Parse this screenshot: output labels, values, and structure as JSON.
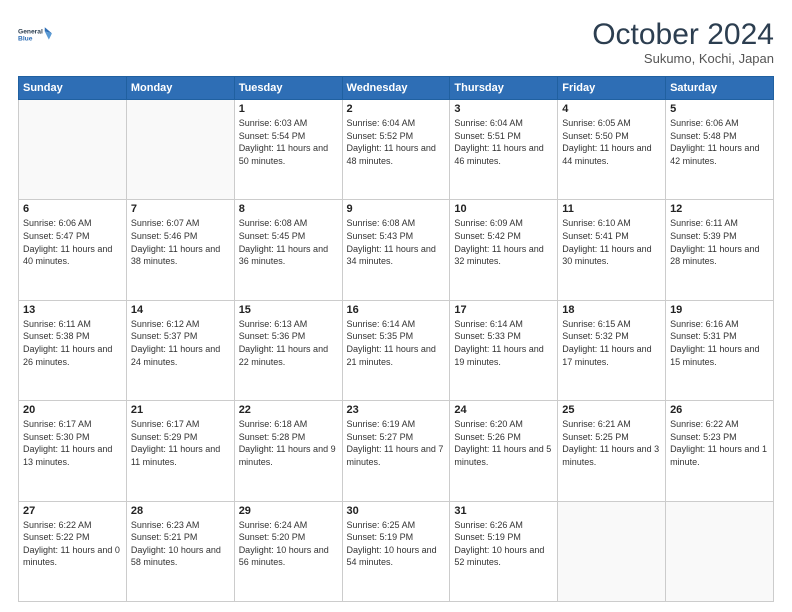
{
  "header": {
    "logo_line1": "General",
    "logo_line2": "Blue",
    "month": "October 2024",
    "location": "Sukumo, Kochi, Japan"
  },
  "weekdays": [
    "Sunday",
    "Monday",
    "Tuesday",
    "Wednesday",
    "Thursday",
    "Friday",
    "Saturday"
  ],
  "weeks": [
    [
      {
        "day": "",
        "detail": ""
      },
      {
        "day": "",
        "detail": ""
      },
      {
        "day": "1",
        "detail": "Sunrise: 6:03 AM\nSunset: 5:54 PM\nDaylight: 11 hours and 50 minutes."
      },
      {
        "day": "2",
        "detail": "Sunrise: 6:04 AM\nSunset: 5:52 PM\nDaylight: 11 hours and 48 minutes."
      },
      {
        "day": "3",
        "detail": "Sunrise: 6:04 AM\nSunset: 5:51 PM\nDaylight: 11 hours and 46 minutes."
      },
      {
        "day": "4",
        "detail": "Sunrise: 6:05 AM\nSunset: 5:50 PM\nDaylight: 11 hours and 44 minutes."
      },
      {
        "day": "5",
        "detail": "Sunrise: 6:06 AM\nSunset: 5:48 PM\nDaylight: 11 hours and 42 minutes."
      }
    ],
    [
      {
        "day": "6",
        "detail": "Sunrise: 6:06 AM\nSunset: 5:47 PM\nDaylight: 11 hours and 40 minutes."
      },
      {
        "day": "7",
        "detail": "Sunrise: 6:07 AM\nSunset: 5:46 PM\nDaylight: 11 hours and 38 minutes."
      },
      {
        "day": "8",
        "detail": "Sunrise: 6:08 AM\nSunset: 5:45 PM\nDaylight: 11 hours and 36 minutes."
      },
      {
        "day": "9",
        "detail": "Sunrise: 6:08 AM\nSunset: 5:43 PM\nDaylight: 11 hours and 34 minutes."
      },
      {
        "day": "10",
        "detail": "Sunrise: 6:09 AM\nSunset: 5:42 PM\nDaylight: 11 hours and 32 minutes."
      },
      {
        "day": "11",
        "detail": "Sunrise: 6:10 AM\nSunset: 5:41 PM\nDaylight: 11 hours and 30 minutes."
      },
      {
        "day": "12",
        "detail": "Sunrise: 6:11 AM\nSunset: 5:39 PM\nDaylight: 11 hours and 28 minutes."
      }
    ],
    [
      {
        "day": "13",
        "detail": "Sunrise: 6:11 AM\nSunset: 5:38 PM\nDaylight: 11 hours and 26 minutes."
      },
      {
        "day": "14",
        "detail": "Sunrise: 6:12 AM\nSunset: 5:37 PM\nDaylight: 11 hours and 24 minutes."
      },
      {
        "day": "15",
        "detail": "Sunrise: 6:13 AM\nSunset: 5:36 PM\nDaylight: 11 hours and 22 minutes."
      },
      {
        "day": "16",
        "detail": "Sunrise: 6:14 AM\nSunset: 5:35 PM\nDaylight: 11 hours and 21 minutes."
      },
      {
        "day": "17",
        "detail": "Sunrise: 6:14 AM\nSunset: 5:33 PM\nDaylight: 11 hours and 19 minutes."
      },
      {
        "day": "18",
        "detail": "Sunrise: 6:15 AM\nSunset: 5:32 PM\nDaylight: 11 hours and 17 minutes."
      },
      {
        "day": "19",
        "detail": "Sunrise: 6:16 AM\nSunset: 5:31 PM\nDaylight: 11 hours and 15 minutes."
      }
    ],
    [
      {
        "day": "20",
        "detail": "Sunrise: 6:17 AM\nSunset: 5:30 PM\nDaylight: 11 hours and 13 minutes."
      },
      {
        "day": "21",
        "detail": "Sunrise: 6:17 AM\nSunset: 5:29 PM\nDaylight: 11 hours and 11 minutes."
      },
      {
        "day": "22",
        "detail": "Sunrise: 6:18 AM\nSunset: 5:28 PM\nDaylight: 11 hours and 9 minutes."
      },
      {
        "day": "23",
        "detail": "Sunrise: 6:19 AM\nSunset: 5:27 PM\nDaylight: 11 hours and 7 minutes."
      },
      {
        "day": "24",
        "detail": "Sunrise: 6:20 AM\nSunset: 5:26 PM\nDaylight: 11 hours and 5 minutes."
      },
      {
        "day": "25",
        "detail": "Sunrise: 6:21 AM\nSunset: 5:25 PM\nDaylight: 11 hours and 3 minutes."
      },
      {
        "day": "26",
        "detail": "Sunrise: 6:22 AM\nSunset: 5:23 PM\nDaylight: 11 hours and 1 minute."
      }
    ],
    [
      {
        "day": "27",
        "detail": "Sunrise: 6:22 AM\nSunset: 5:22 PM\nDaylight: 11 hours and 0 minutes."
      },
      {
        "day": "28",
        "detail": "Sunrise: 6:23 AM\nSunset: 5:21 PM\nDaylight: 10 hours and 58 minutes."
      },
      {
        "day": "29",
        "detail": "Sunrise: 6:24 AM\nSunset: 5:20 PM\nDaylight: 10 hours and 56 minutes."
      },
      {
        "day": "30",
        "detail": "Sunrise: 6:25 AM\nSunset: 5:19 PM\nDaylight: 10 hours and 54 minutes."
      },
      {
        "day": "31",
        "detail": "Sunrise: 6:26 AM\nSunset: 5:19 PM\nDaylight: 10 hours and 52 minutes."
      },
      {
        "day": "",
        "detail": ""
      },
      {
        "day": "",
        "detail": ""
      }
    ]
  ]
}
